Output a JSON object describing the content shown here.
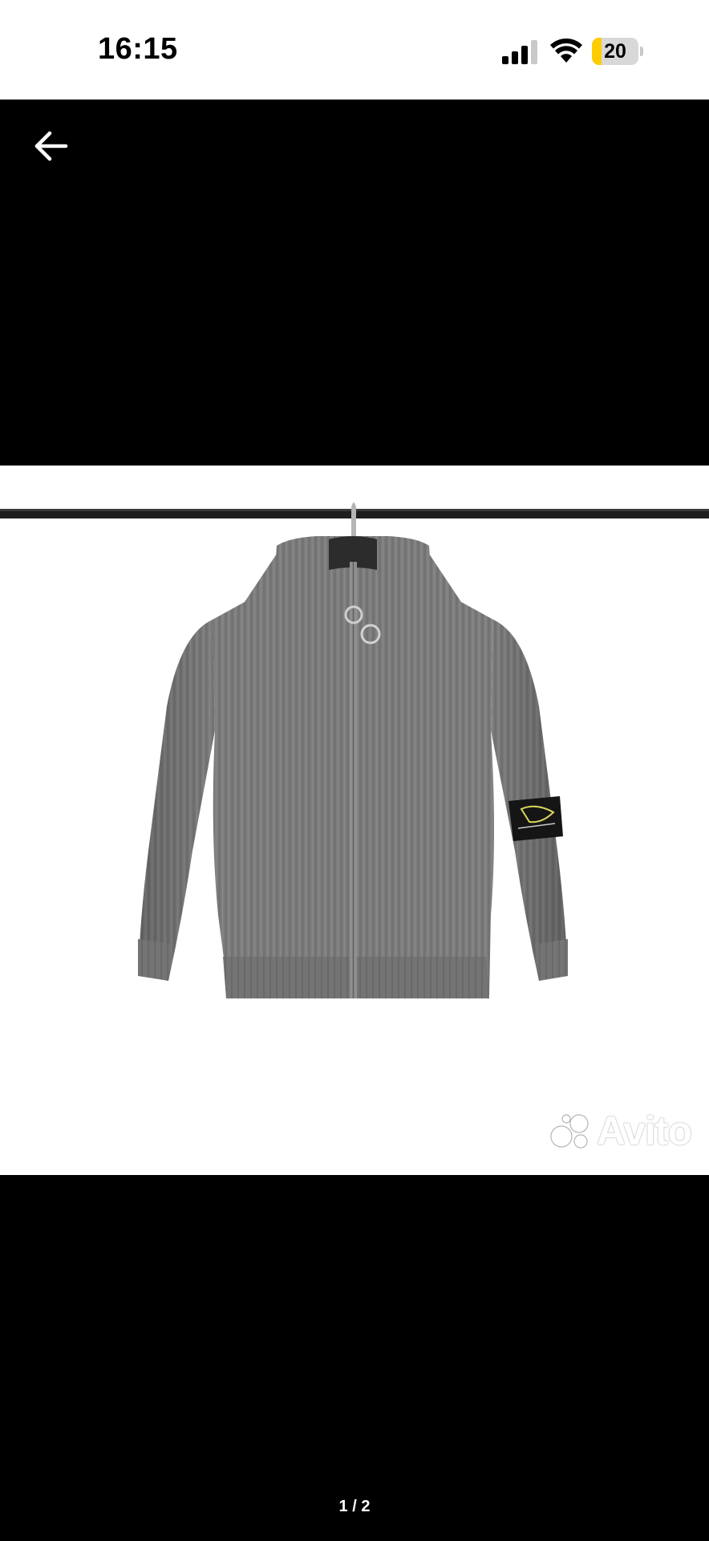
{
  "status_bar": {
    "time": "16:15",
    "battery_level": 20,
    "battery_text": "20",
    "signal_bars": 3,
    "colors": {
      "battery_fill": "#ffcc00",
      "background": "#ffffff"
    }
  },
  "viewer": {
    "back_icon": "arrow-left-icon",
    "photo_subject": "grey zip knit jumper on hanger",
    "watermark": "Avito",
    "page_indicator": "1 / 2",
    "current_page": 1,
    "total_pages": 2,
    "colors": {
      "background": "#000000",
      "photo_background": "#ffffff",
      "garment": "#7b7b7b"
    }
  }
}
